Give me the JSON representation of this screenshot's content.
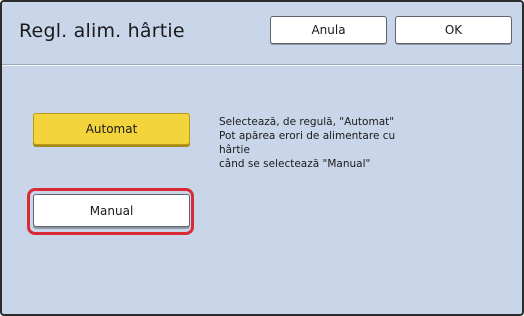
{
  "header": {
    "title": "Regl. alim. hârtie",
    "cancel_label": "Anula",
    "ok_label": "OK"
  },
  "options": {
    "automatic_label": "Automat",
    "manual_label": "Manual",
    "selected": "Automat",
    "highlighted": "Manual"
  },
  "description": {
    "lines": [
      "Selectează, de regulă, \"Automat\"",
      "Pot apărea erori de alimentare cu",
      "hârtie",
      "când se selectează \"Manual\""
    ]
  },
  "colors": {
    "panel_background": "#c9d6ea",
    "selected_button": "#f4d43c",
    "highlight_ring": "#d92a36"
  }
}
